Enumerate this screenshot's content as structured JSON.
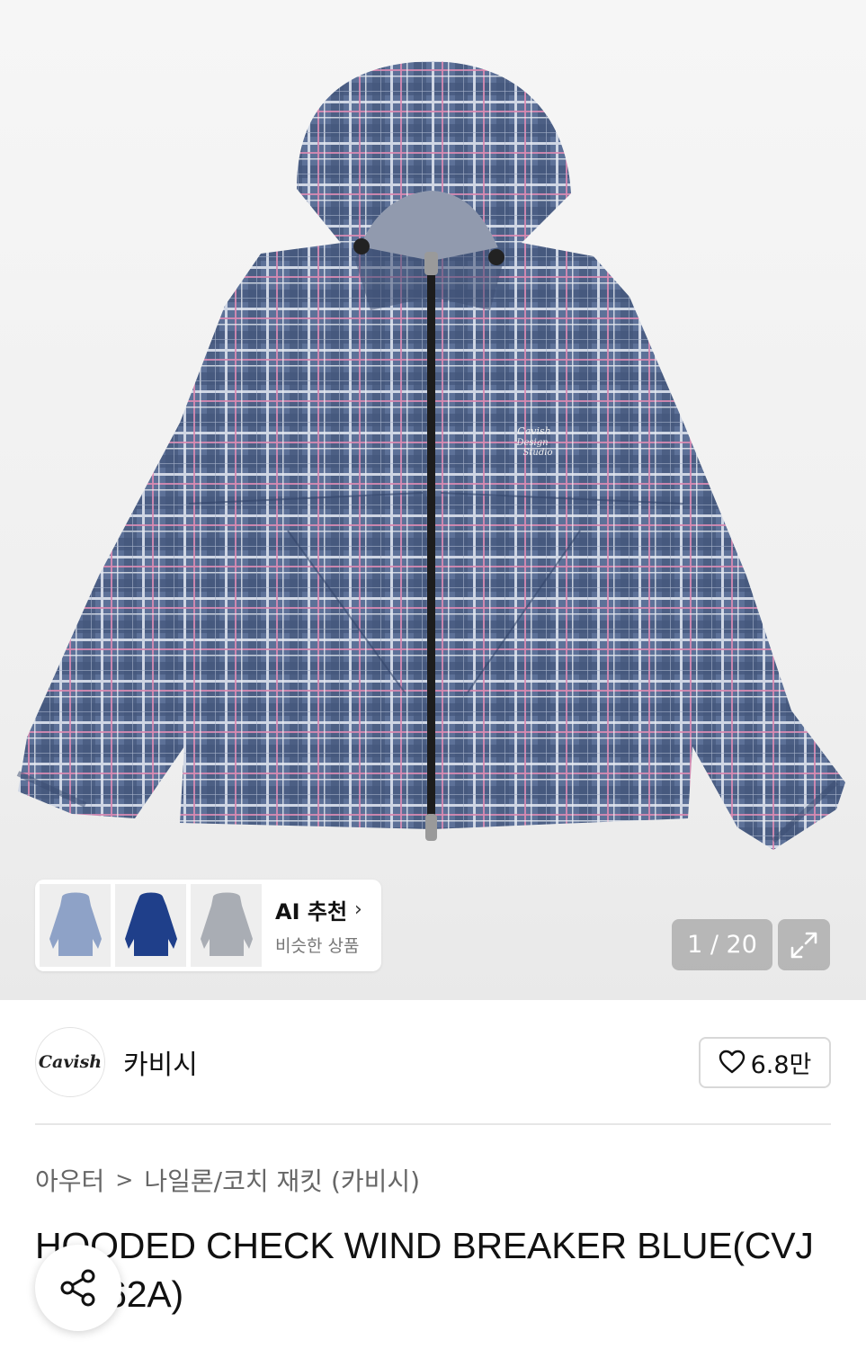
{
  "product_image": {
    "jacket_logo_text": "Cavish Design Studio",
    "counter": "1 / 20",
    "colors": {
      "plaid_base": "#5a6f95",
      "plaid_dark": "#3c4f73",
      "plaid_light": "#c9d0df",
      "plaid_pink": "#d98bb3",
      "zipper": "#1d1d1d"
    }
  },
  "ai_recommend": {
    "title": "AI 추천",
    "chevron": "›",
    "subtitle": "비슷한 상품",
    "thumbnails": [
      {
        "name": "light-blue-jacket",
        "color": "#8ea2c7"
      },
      {
        "name": "navy-jacket",
        "color": "#1f3f8a"
      },
      {
        "name": "grey-jacket",
        "color": "#a9adb4"
      }
    ]
  },
  "brand": {
    "logo_text": "Cavish",
    "name": "카비시",
    "likes": "6.8만"
  },
  "breadcrumb": {
    "category": "아우터",
    "separator": ">",
    "subcategory": "나일론/코치 재킷 (카비시)"
  },
  "product": {
    "title": "HOODED CHECK WIND BREAKER BLUE(CVJUB962A)"
  }
}
